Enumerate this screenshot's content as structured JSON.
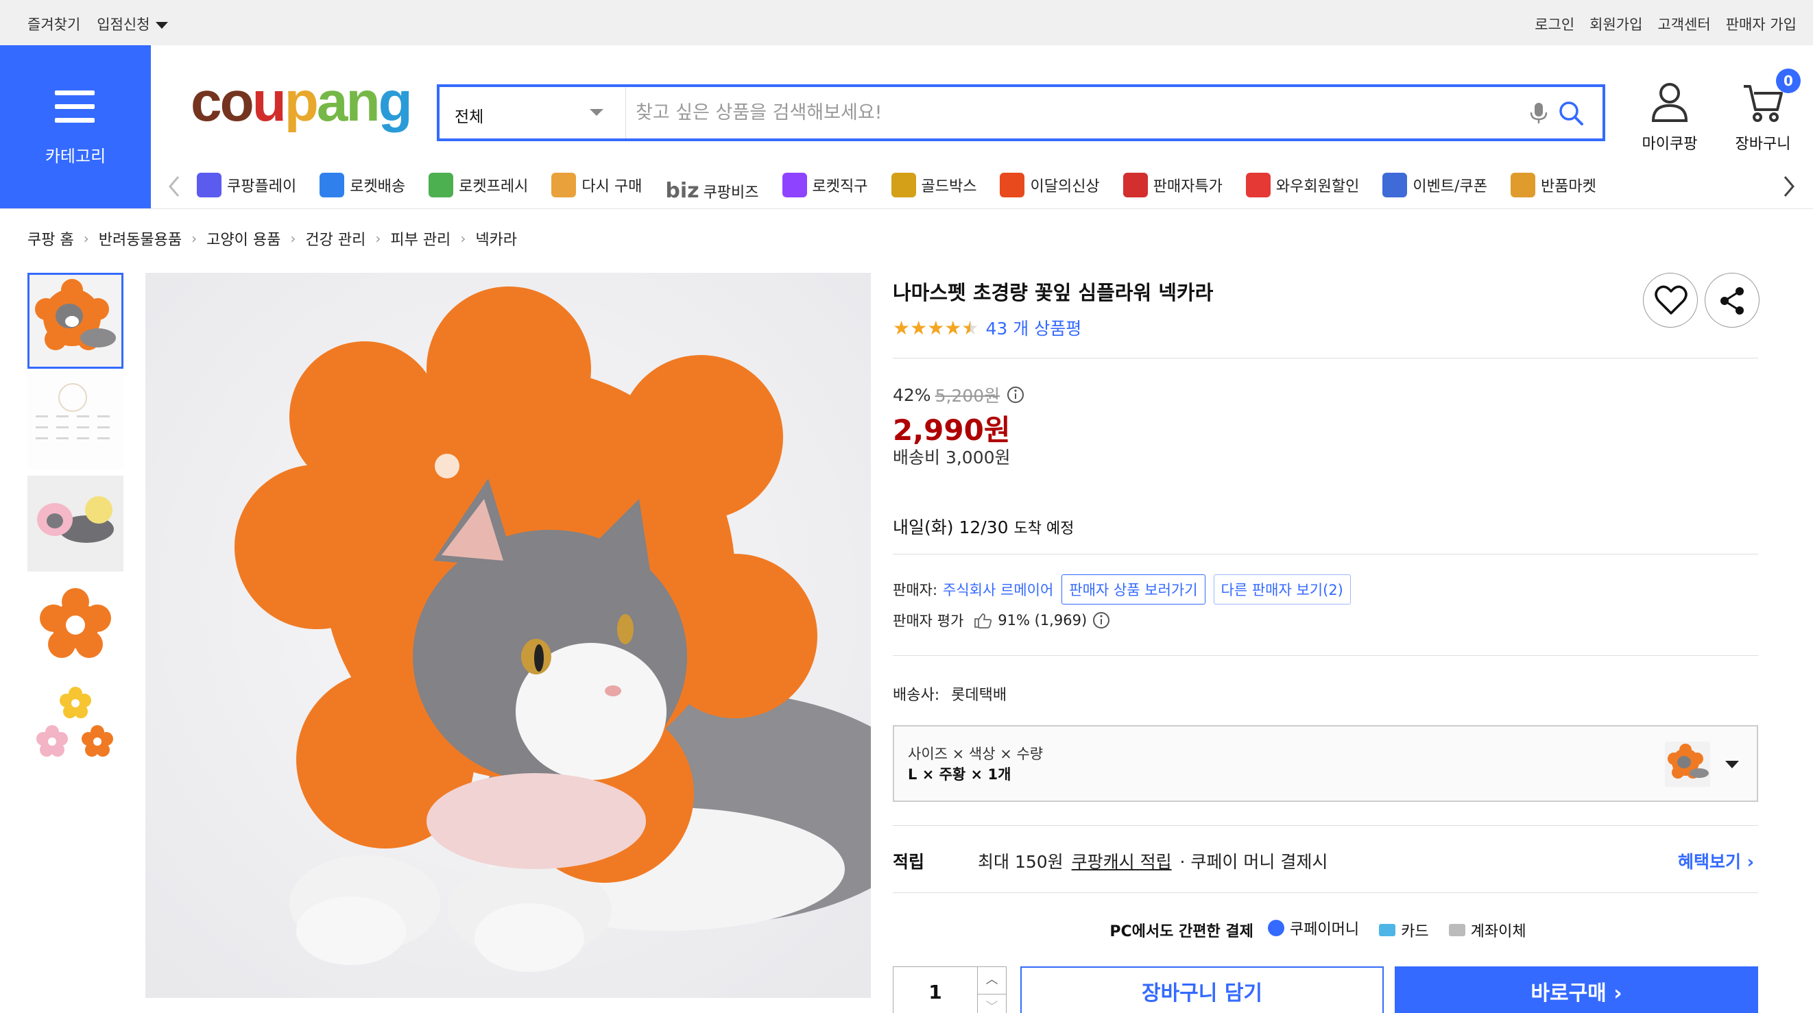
{
  "topbar": {
    "favorites": "즐겨찾기",
    "partner_apply": "입점신청",
    "login": "로그인",
    "signup": "회원가입",
    "support": "고객센터",
    "seller_signup": "판매자 가입"
  },
  "header": {
    "category_label": "카테고리",
    "logo": [
      "co",
      "u",
      "p",
      "an",
      "g"
    ],
    "search_scope": "전체",
    "search_placeholder": "찾고 싶은 상품을 검색해보세요!",
    "my_coupang": "마이쿠팡",
    "cart": "장바구니",
    "cart_count": "0"
  },
  "services": [
    {
      "label": "쿠팡플레이",
      "color": "#5b5bf0"
    },
    {
      "label": "로켓배송",
      "color": "#2f80ed"
    },
    {
      "label": "로켓프레시",
      "color": "#4caf50"
    },
    {
      "label": "다시 구매",
      "color": "#e9a13b"
    },
    {
      "label": "쿠팡비즈",
      "prefix": "biz",
      "color": "#666666"
    },
    {
      "label": "로켓직구",
      "color": "#8e44ff"
    },
    {
      "label": "골드박스",
      "color": "#d4a017"
    },
    {
      "label": "이달의신상",
      "color": "#e8491d"
    },
    {
      "label": "판매자특가",
      "color": "#d32f2f"
    },
    {
      "label": "와우회원할인",
      "color": "#e53935"
    },
    {
      "label": "이벤트/쿠폰",
      "color": "#3f6bd8"
    },
    {
      "label": "반품마켓",
      "color": "#e09b2d"
    }
  ],
  "breadcrumb": [
    "쿠팡 홈",
    "반려동물용품",
    "고양이 용품",
    "건강 관리",
    "피부 관리",
    "넥카라"
  ],
  "product": {
    "title": "나마스펫 초경량 꽃잎 심플라워 넥카라",
    "rating": 4.5,
    "review_count": "43 개 상품평",
    "discount_rate": "42%",
    "original_price": "5,200원",
    "price": "2,990원",
    "shipping_fee": "배송비 3,000원",
    "arrival_main": "내일(화) 12/30",
    "arrival_suffix": "도착 예정",
    "seller_label": "판매자:",
    "seller_name": "주식회사 르메이어",
    "seller_products_btn": "판매자 상품 보러가기",
    "other_sellers_btn": "다른 판매자 보기(2)",
    "seller_rating_label": "판매자 평가",
    "seller_rating_value": "91% (1,969)",
    "courier_label": "배송사:",
    "courier_name": "롯데택배",
    "option_header": "사이즈 × 색상 × 수량",
    "option_value": "L × 주황 × 1개",
    "reward_label": "적립",
    "reward_text_1": "최대 150원",
    "reward_link": "쿠팡캐시 적립",
    "reward_text_2": "· 쿠페이 머니 결제시",
    "benefit_link": "혜택보기",
    "pay_title": "PC에서도 간편한 결제",
    "pay_methods": [
      "쿠페이머니",
      "카드",
      "계좌이체"
    ],
    "quantity": "1",
    "add_to_cart": "장바구니 담기",
    "buy_now": "바로구매"
  },
  "colors": {
    "accent": "#346aff",
    "price": "#ae0000",
    "star": "#f4a522",
    "collar": "#f07a23"
  }
}
